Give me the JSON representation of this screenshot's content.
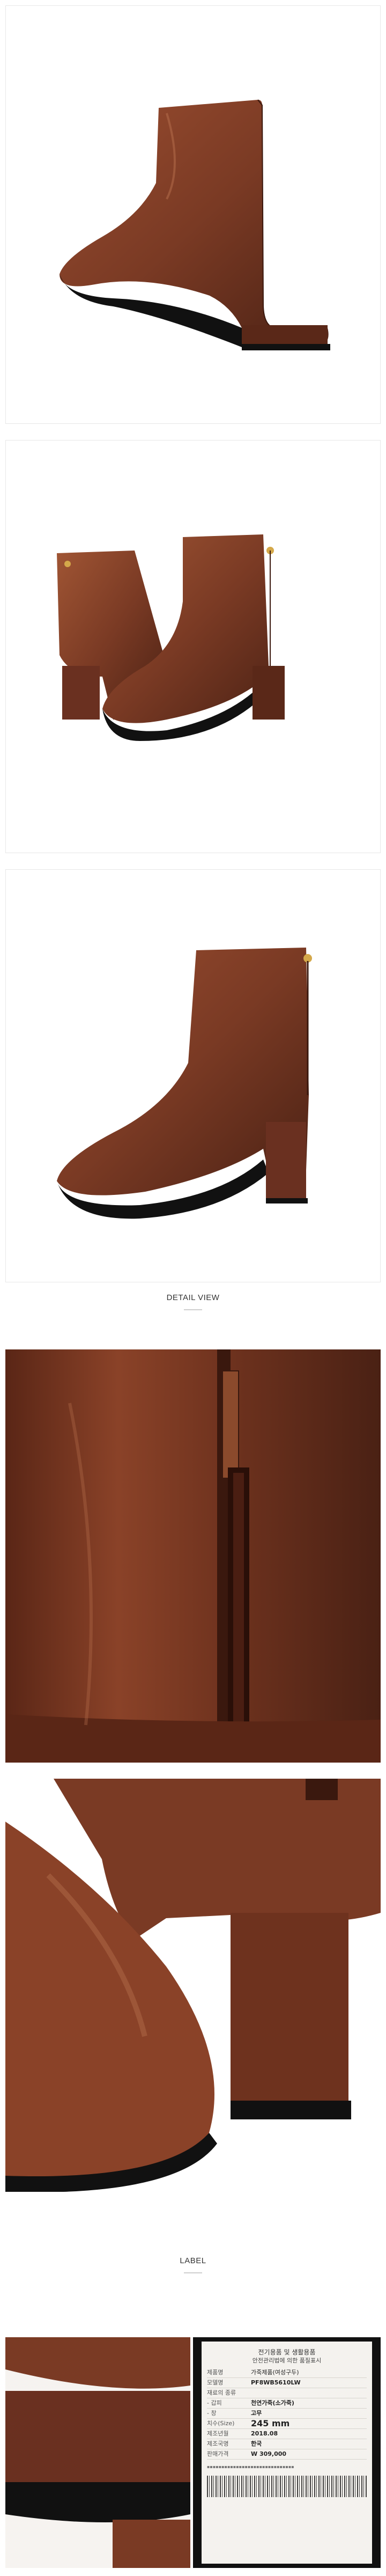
{
  "sections": {
    "detail_heading": "DETAIL VIEW",
    "label_heading": "LABEL"
  },
  "colors": {
    "leather": "#7a3a24",
    "leather_dark": "#4a2114",
    "leather_light": "#a65a3a",
    "sole": "#111111"
  },
  "label": {
    "title": "전기용품 및 생활용품",
    "subtitle": "안전관리법에 의한 품질표시",
    "rows": [
      {
        "k": "제품명",
        "v": "가죽제품(여성구두)"
      },
      {
        "k": "모델명",
        "v": "PF8WB5610LW"
      },
      {
        "k": "재료의 종류",
        "v": ""
      },
      {
        "k": "- 갑피",
        "v": "천연가죽(소가죽)"
      },
      {
        "k": "- 창",
        "v": "고무"
      },
      {
        "k": "치수(Size)",
        "v": "245 mm"
      },
      {
        "k": "제조년월",
        "v": "2018.08"
      },
      {
        "k": "제조국명",
        "v": "한국"
      },
      {
        "k": "판매가격",
        "v": "W 309,000"
      }
    ]
  }
}
